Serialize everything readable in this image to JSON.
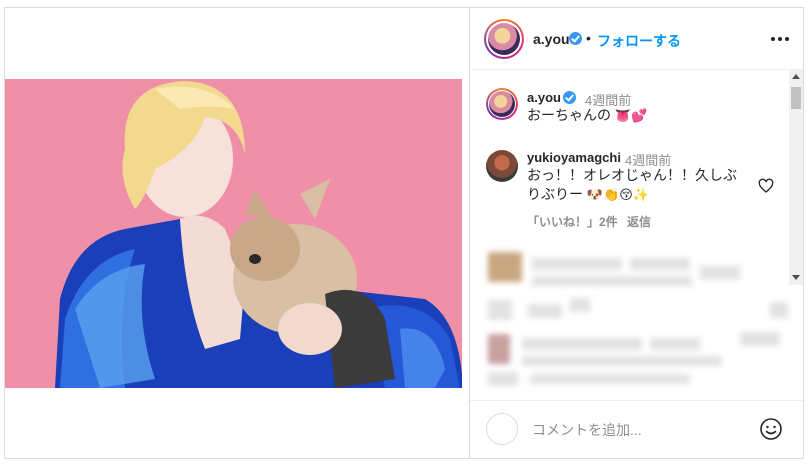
{
  "post": {
    "author": {
      "username": "a.you",
      "verified": true,
      "follow_label": "フォローする",
      "separator": "•"
    },
    "more_icon": "more-horizontal-icon",
    "comments": [
      {
        "username": "a.you",
        "verified": true,
        "time": "4週間前",
        "text": "おーちゃんの",
        "emoji": "👅💕"
      },
      {
        "username": "yukioyamagchi",
        "time": "4週間前",
        "text_line1": "おっ！！オレオじゃん！！久しぶ",
        "text_line2": "りぶりー",
        "emoji": "🐶👏😚✨",
        "likes_label": "「いいね！」2件",
        "reply_label": "返信"
      }
    ],
    "comment_input": {
      "placeholder": "コメントを追加...",
      "value": ""
    },
    "colors": {
      "photo_background": "#ef90a8",
      "follow_blue": "#0095f6",
      "verified_blue": "#3897f0",
      "meta_gray": "#8e8e8e"
    }
  }
}
